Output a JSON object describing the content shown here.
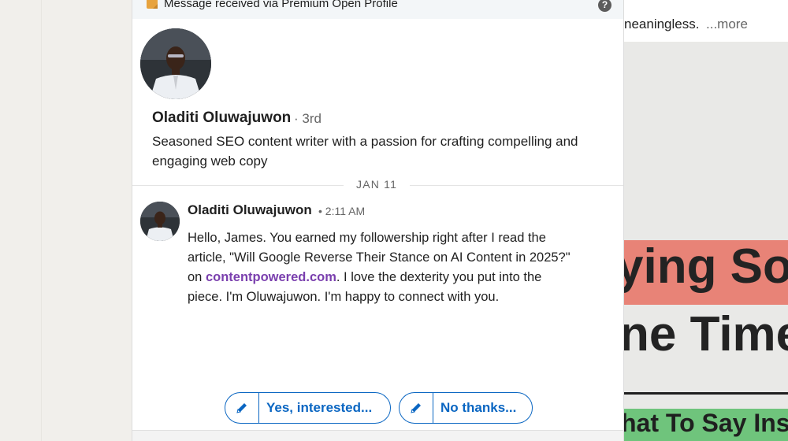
{
  "banner": {
    "text": "Message received via Premium Open Profile",
    "help_glyph": "?"
  },
  "profile": {
    "name": "Oladiti Oluwajuwon",
    "degree": "· 3rd",
    "headline": "Seasoned SEO content writer with a passion for crafting compelling and engaging web copy"
  },
  "conversation": {
    "date": "JAN 11",
    "message": {
      "sender": "Oladiti Oluwajuwon",
      "time": "• 2:11 AM",
      "body_before_link": "Hello, James. You earned my followership right after I read the article, \"Will Google Reverse Their Stance on AI Content in 2025?\" on ",
      "link_text": "contentpowered.com",
      "body_after_link": ". I love the dexterity you put into the piece. I'm Oluwajuwon. I'm happy to connect with you."
    }
  },
  "replies": {
    "yes_label": "Yes, interested...",
    "no_label": "No thanks..."
  },
  "feed": {
    "snippet": "neaningless.",
    "more_label": "...more",
    "image_line1": "ying So",
    "image_line2": "ne Time",
    "image_line3": "hat To Say Inst"
  },
  "colors": {
    "accent": "#0a66c2",
    "link": "#7a3fae",
    "premium_icon": "#e7a33e"
  },
  "icons": {
    "premium": "premium-badge-icon",
    "help": "help-icon",
    "edit": "pencil-icon"
  }
}
